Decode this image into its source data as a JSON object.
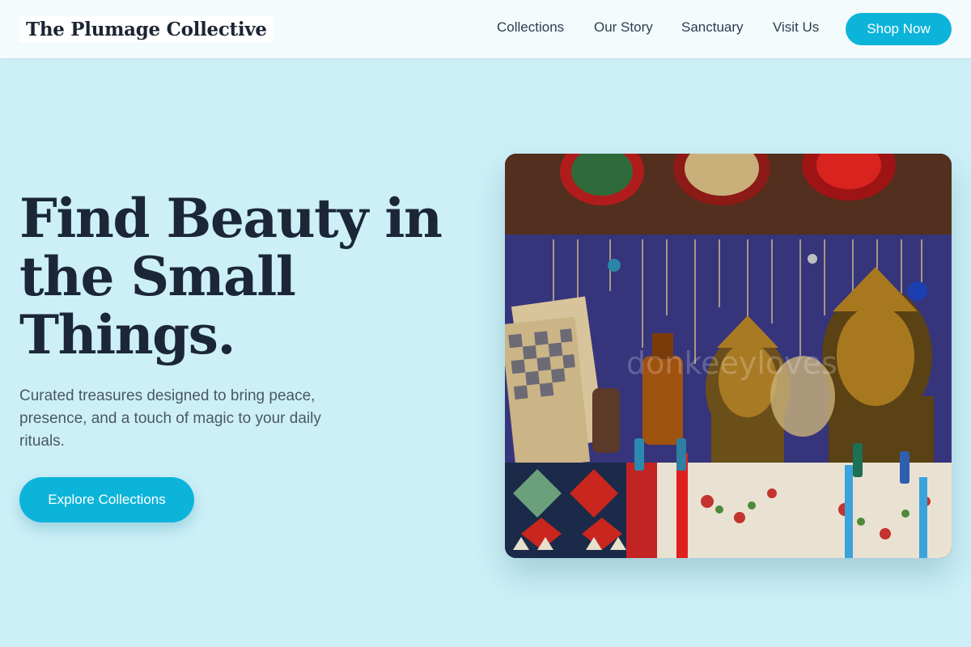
{
  "header": {
    "brand": "The Plumage Collective",
    "nav": [
      "Collections",
      "Our Story",
      "Sanctuary",
      "Visit Us"
    ],
    "cta_label": "Shop Now"
  },
  "hero": {
    "title": "Find Beauty in the Small Things.",
    "subtitle": "Curated treasures designed to bring peace, presence, and a touch of magic to your daily rituals.",
    "button_label": "Explore Collections",
    "image_watermark": "donkeeyloves"
  },
  "colors": {
    "background": "#cdf0f8",
    "accent": "#0cb4da",
    "heading": "#1b2738",
    "navbar": "#f4fbfd"
  }
}
